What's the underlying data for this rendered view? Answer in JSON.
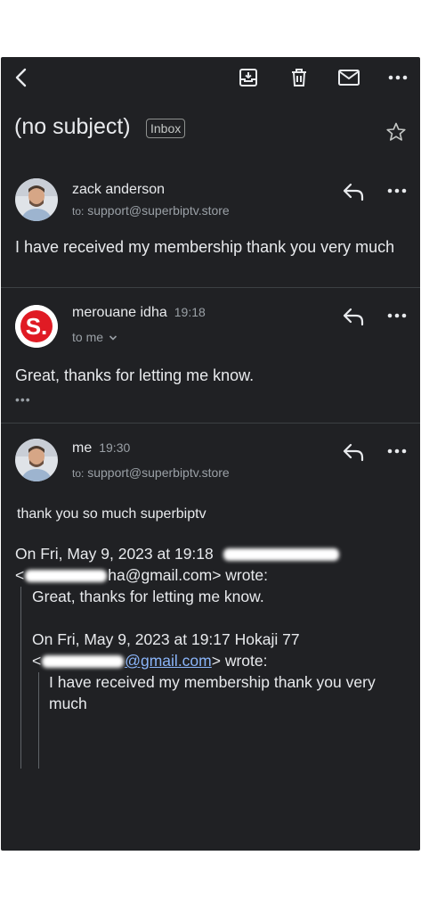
{
  "thread": {
    "subject": "(no subject)",
    "label": "Inbox"
  },
  "toolbar": {
    "icons": [
      "back-icon",
      "archive-icon",
      "trash-icon",
      "mail-icon",
      "more-icon"
    ]
  },
  "messages": [
    {
      "sender": "zack anderson",
      "time": "",
      "to_label": "to:",
      "to": "support@superbiptv.store",
      "body": "I have received my membership thank you very much"
    },
    {
      "sender": "merouane idha",
      "time": "19:18",
      "to": "to me",
      "avatar_letter": "S.",
      "body": "Great, thanks for letting me know.",
      "collapsed": "•••"
    },
    {
      "sender": "me",
      "time": "19:30",
      "to_label": "to:",
      "to": "support@superbiptv.store",
      "body": "thank you so much superbiptv",
      "quote1_head": "On Fri, May 9, 2023 at 19:18",
      "quote1_addr_tail": "ha@gmail.com> wrote:",
      "quote1_open": "<",
      "quote1_body": "Great, thanks for letting me know.",
      "quote2_head": "On Fri, May 9, 2023 at 19:17 Hokaji 77",
      "quote2_open": "<",
      "quote2_link": "@gmail.com",
      "quote2_close": "> wrote:",
      "quote2_body": "I have received my membership thank you very much"
    }
  ],
  "colors": {
    "background": "#202124",
    "text": "#e8eaed",
    "muted": "#9aa0a6",
    "link": "#8ab4f8",
    "avatar_brand": "#e01b24"
  }
}
